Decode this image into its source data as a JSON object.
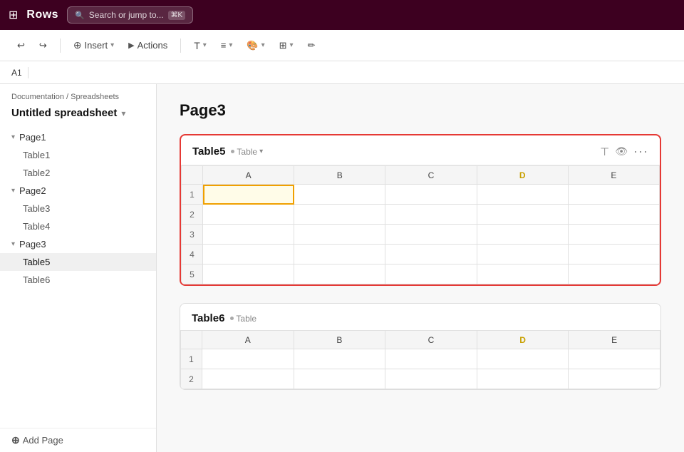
{
  "topbar": {
    "title": "Rows",
    "search_placeholder": "Search or jump to...",
    "kbd": "⌘K"
  },
  "toolbar": {
    "undo": "↩",
    "redo": "↪",
    "insert": "Insert",
    "actions": "Actions",
    "font": "T",
    "align": "≡",
    "format": "🎨",
    "layout": "⊞",
    "brush": "✏"
  },
  "address_bar": {
    "cell": "A1"
  },
  "sidebar": {
    "breadcrumb": "Documentation / Spreadsheets",
    "title": "Untitled spreadsheet",
    "pages": [
      {
        "name": "Page1",
        "expanded": true,
        "tables": [
          "Table1",
          "Table2"
        ]
      },
      {
        "name": "Page2",
        "expanded": true,
        "tables": [
          "Table3",
          "Table4"
        ]
      },
      {
        "name": "Page3",
        "expanded": true,
        "tables": [
          "Table5",
          "Table6"
        ]
      }
    ],
    "active_table": "Table5",
    "add_page": "Add Page"
  },
  "content": {
    "page_title": "Page3",
    "table5": {
      "name": "Table5",
      "type": "Table",
      "columns": [
        "A",
        "B",
        "C",
        "D",
        "E"
      ],
      "rows": 5
    },
    "table6": {
      "name": "Table6",
      "type": "Table",
      "columns": [
        "A",
        "B",
        "C",
        "D",
        "E"
      ],
      "rows": 2
    }
  }
}
